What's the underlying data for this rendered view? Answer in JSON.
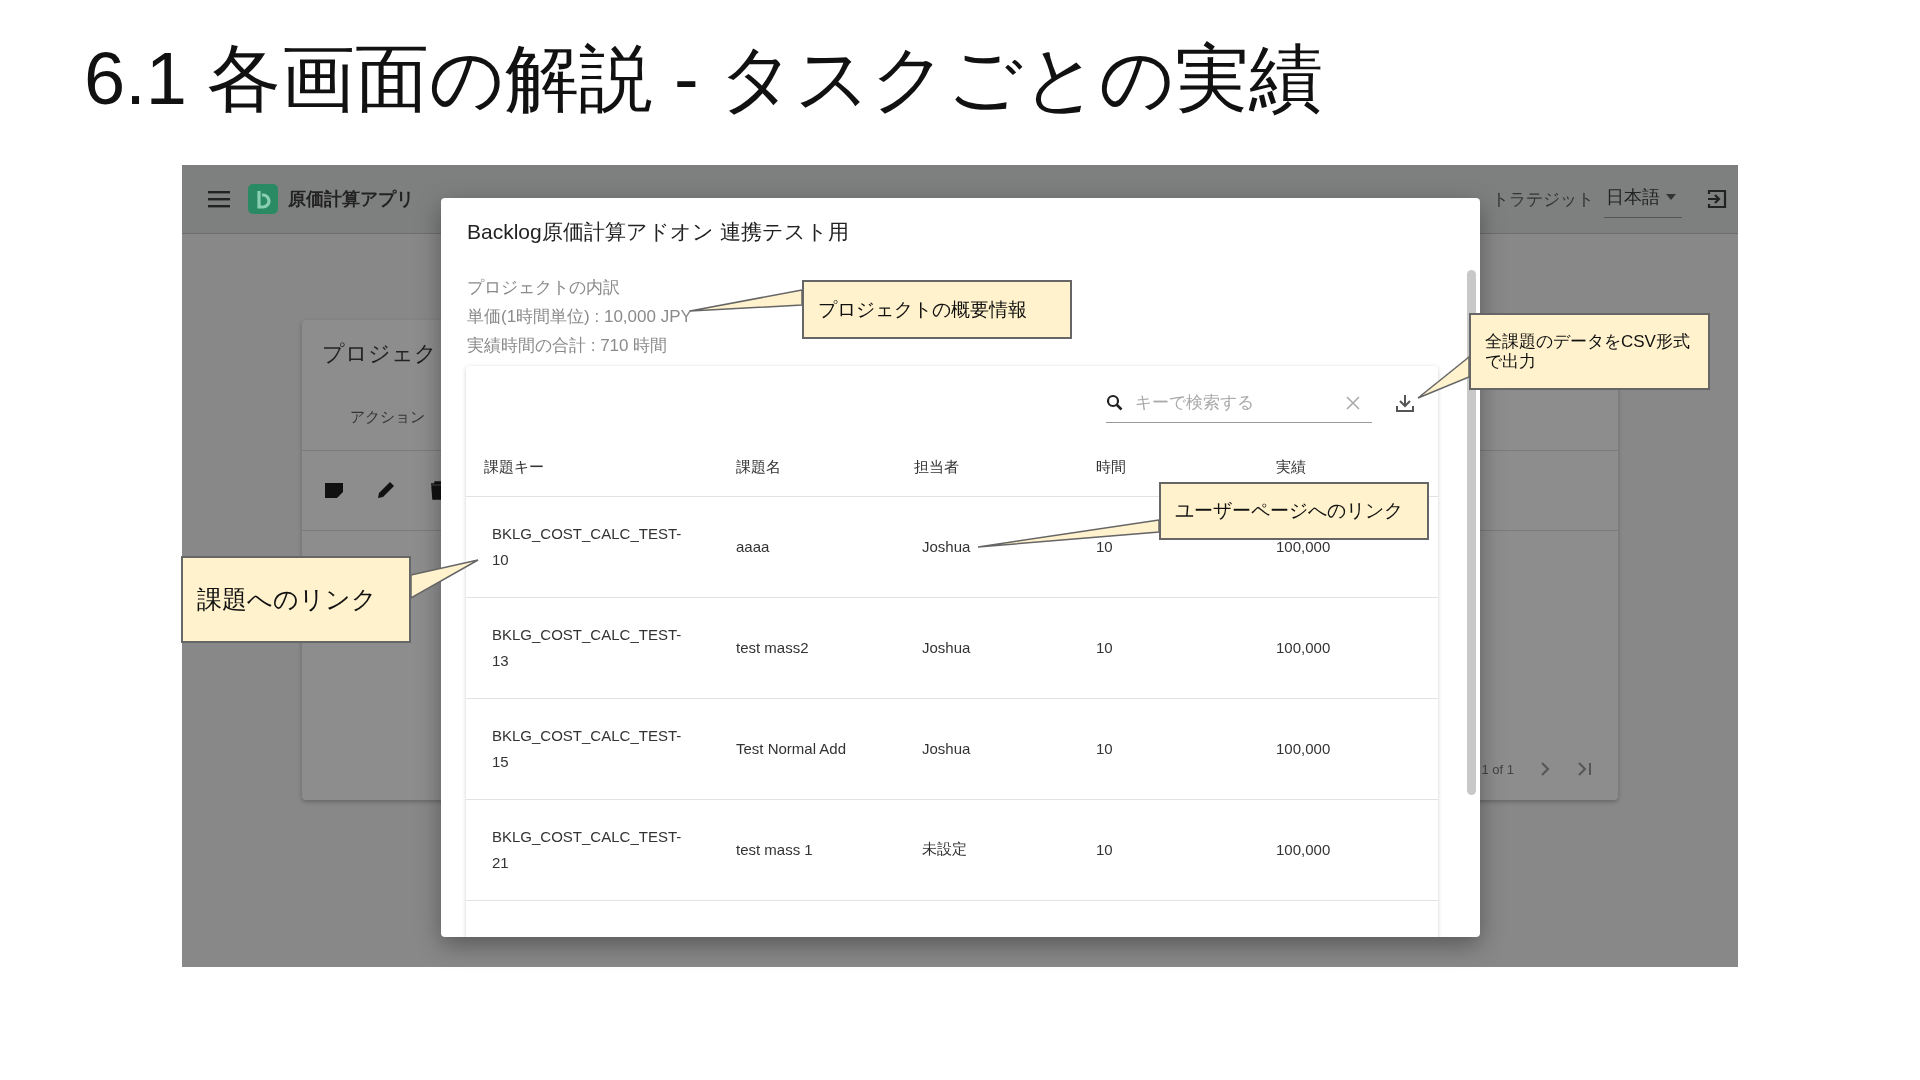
{
  "slide_title": "6.1 各画面の解説 - タスクごとの実績",
  "app": {
    "name": "原価計算アプリ",
    "space": "トラテジット",
    "language": "日本語",
    "card_title": "プロジェク",
    "column_label": "アクション",
    "pagination": "1 of 1"
  },
  "dialog": {
    "title": "Backlog原価計算アドオン 連携テスト用",
    "summary": [
      "プロジェクトの内訳",
      "単価(1時間単位) : 10,000 JPY",
      "実績時間の合計 : 710 時間"
    ],
    "search": {
      "placeholder": "キーで検索する"
    },
    "table": {
      "columns": [
        "課題キー",
        "課題名",
        "担当者",
        "時間",
        "実績"
      ],
      "rows": [
        {
          "key": "BKLG_COST_CALC_TEST-10",
          "name": "aaaa",
          "assignee": "Joshua",
          "hours": "10",
          "cost": "100,000"
        },
        {
          "key": "BKLG_COST_CALC_TEST-13",
          "name": "test mass2",
          "assignee": "Joshua",
          "hours": "10",
          "cost": "100,000"
        },
        {
          "key": "BKLG_COST_CALC_TEST-15",
          "name": "Test Normal Add",
          "assignee": "Joshua",
          "hours": "10",
          "cost": "100,000"
        },
        {
          "key": "BKLG_COST_CALC_TEST-21",
          "name": "test mass 1",
          "assignee": "未設定",
          "hours": "10",
          "cost": "100,000"
        }
      ]
    }
  },
  "callouts": [
    {
      "text": "プロジェクトの概要情報"
    },
    {
      "text": "全課題のデータをCSV形式で出力"
    },
    {
      "text": "ユーザーページへのリンク"
    },
    {
      "text": "課題へのリンク"
    }
  ]
}
